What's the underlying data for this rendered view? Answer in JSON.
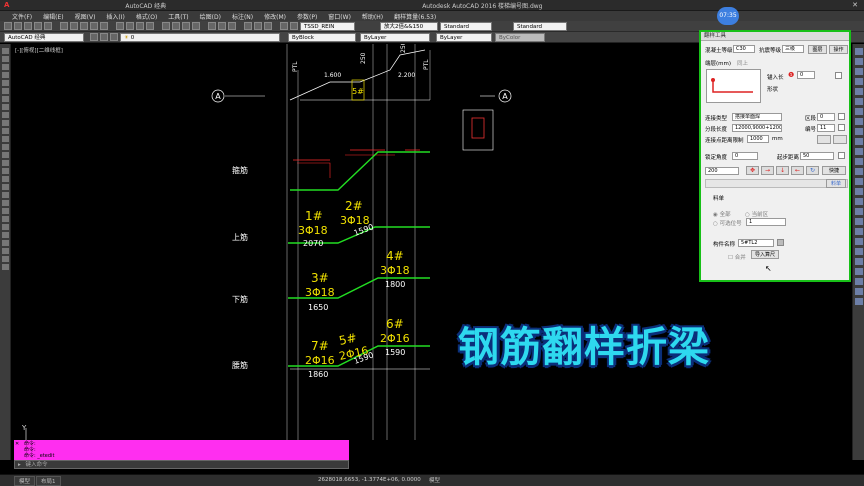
{
  "app": {
    "window_title": "Autodesk AutoCAD 2016    楼梯编号图.dwg",
    "workspace": "AutoCAD 经典",
    "time_badge": "07:35"
  },
  "menu": [
    "文件(F)",
    "编辑(E)",
    "视图(V)",
    "插入(I)",
    "格式(O)",
    "工具(T)",
    "绘图(D)",
    "标注(N)",
    "修改(M)",
    "参数(P)",
    "窗口(W)",
    "帮助(H)",
    "翻样算量(6.53)"
  ],
  "toolbar1": {
    "textstyle": "TSSD_REIN",
    "dimstyle": "放大2倍&&150",
    "style1": "Standard",
    "style2": "Standard"
  },
  "toolbar2": {
    "workspace": "AutoCAD 经典",
    "layer": "0",
    "color": "ByBlock",
    "linetype": "ByLayer",
    "lineweight": "ByLayer",
    "plotstyle": "ByColor"
  },
  "view_label": "[-][俯视][二维线框]",
  "drawing": {
    "axis_label": "A",
    "dims": [
      "1.600",
      "2.200",
      "250",
      "250",
      "PTL",
      "PTL"
    ],
    "stair_label": "5#",
    "row_labels": [
      "箍筋",
      "上筋",
      "下筋",
      "腰筋"
    ],
    "rebars": [
      {
        "id": "1#",
        "spec": "3Φ18",
        "len": "2070"
      },
      {
        "id": "2#",
        "spec": "3Φ18",
        "len": "1590"
      },
      {
        "id": "3#",
        "spec": "3Φ18",
        "len": "1650"
      },
      {
        "id": "4#",
        "spec": "3Φ18",
        "len": "1800"
      },
      {
        "id": "5#",
        "spec": "2Φ16",
        "len": "1590"
      },
      {
        "id": "6#",
        "spec": "2Φ16",
        "len": "1590"
      },
      {
        "id": "7#",
        "spec": "2Φ16",
        "len": "1860"
      }
    ]
  },
  "panel": {
    "title": "翻样工具",
    "concrete_label": "混凝土等级",
    "concrete_value": "C30",
    "seismic_label": "抗震等级",
    "seismic_value": "三级",
    "btn_drawing": "图层",
    "btn_operate": "操作",
    "cover_label": "端层(mm)",
    "cover_value": "同上",
    "anchor_label": "锚入长",
    "anchor_value": "0",
    "shape_label": "形状",
    "conn_type_label": "连接类型",
    "conn_type_value": "搭接单面焊",
    "seg_len_label": "分段长度",
    "seg_len_value": "12000,9000+1200K",
    "min_dist_label": "连接点距离限制",
    "min_dist_value": "1000",
    "min_dist_unit": "mm",
    "region_label": "区段",
    "region_value": "0",
    "code_label": "编号",
    "code_value": "11",
    "lock_angle_label": "锁定角度",
    "lock_angle_value": "0",
    "start_dist_label": "起步距离",
    "start_dist_value": "50",
    "spacing_value": "200",
    "btn_quick": "快捷",
    "tab_material": "料单",
    "tab_right": "料单",
    "radio_all": "全部",
    "radio_current": "当前区",
    "radio_optional": "可选位号",
    "optional_value": "1",
    "member_label": "构件名称",
    "member_value": "5#TL2",
    "merge_label": "合并",
    "btn_import": "导入算尺"
  },
  "command": {
    "lines": [
      "命令:",
      "命令:",
      "命令: _etedit"
    ],
    "placeholder": "键入命令"
  },
  "status": {
    "tabs": [
      "模型",
      "布局1"
    ],
    "coords": "2628018.6653, -1.3774E+06, 0.0000",
    "model_btn": "模型"
  },
  "overlay_text": "钢筋翻样折梁",
  "ucs_label": "Y"
}
